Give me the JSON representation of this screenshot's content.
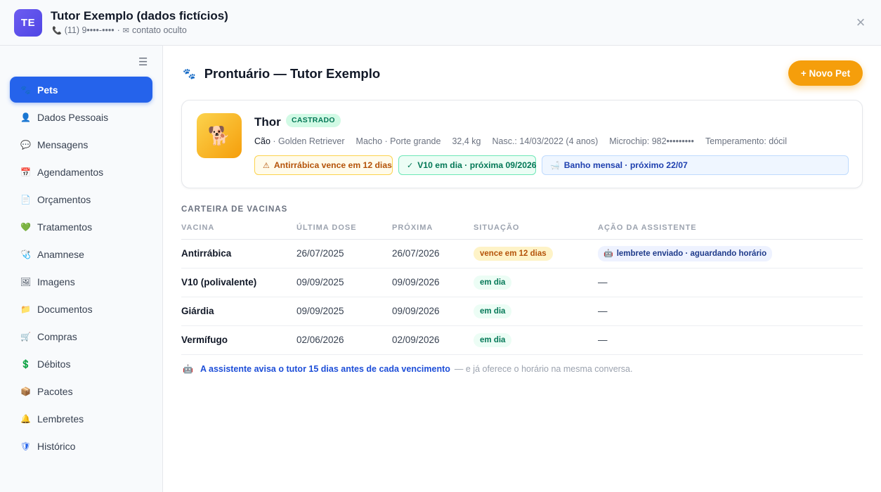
{
  "header": {
    "avatar_initials": "TE",
    "title": "Tutor Exemplo (dados fictícios)",
    "phone_icon": "phone-icon",
    "phone": "(11) 9••••-••••",
    "separator": "·",
    "email_icon": "envelope-icon",
    "email": "contato oculto",
    "close_label": "×"
  },
  "sidebar": {
    "menu_icon": "☰",
    "items": [
      {
        "label": "Pets",
        "icon": "🐾",
        "active": true
      },
      {
        "label": "Dados Pessoais",
        "icon": "👤"
      },
      {
        "label": "Mensagens",
        "icon": "💬"
      },
      {
        "label": "Agendamentos",
        "icon": "📅"
      },
      {
        "label": "Orçamentos",
        "icon": "📄"
      },
      {
        "label": "Tratamentos",
        "icon": "💚"
      },
      {
        "label": "Anamnese",
        "icon": "🩺"
      },
      {
        "label": "Imagens",
        "icon": "🖼"
      },
      {
        "label": "Documentos",
        "icon": "📁"
      },
      {
        "label": "Compras",
        "icon": "🛒"
      },
      {
        "label": "Débitos",
        "icon": "💲"
      },
      {
        "label": "Pacotes",
        "icon": "📦"
      },
      {
        "label": "Lembretes",
        "icon": "🔔"
      },
      {
        "label": "Histórico",
        "icon": "🛡"
      }
    ]
  },
  "main": {
    "title_icon": "🐾",
    "title": "Prontuário — Tutor Exemplo",
    "new_pet_label": "+ Novo Pet"
  },
  "pet": {
    "photo_icon": "🐕",
    "name": "Thor",
    "badge": "CASTRADO",
    "species": "Cão",
    "breed": " · Golden Retriever",
    "sex_size": "Macho · Porte grande",
    "weight": "32,4 kg",
    "birth": "Nasc.: 14/03/2022 (4 anos)",
    "microchip": "Microchip: 982•••••••••",
    "temperament": "Temperamento: dócil",
    "chips": {
      "warn_icon": "⚠",
      "warn": "Antirrábica vence em 12 dias",
      "ok_icon": "✓",
      "ok": "V10 em dia · próxima 09/2026",
      "info_icon": "🛁",
      "info": "Banho mensal · próximo 22/07"
    }
  },
  "vaccines": {
    "section_title": "CARTEIRA DE VACINAS",
    "columns": [
      "VACINA",
      "ÚLTIMA DOSE",
      "PRÓXIMA",
      "SITUAÇÃO",
      "AÇÃO DA ASSISTENTE"
    ],
    "rows": [
      {
        "name": "Antirrábica",
        "last": "26/07/2025",
        "next": "26/07/2026",
        "status": "vence em 12 dias",
        "status_type": "warn",
        "action_icon": "🤖",
        "action": "lembrete enviado · aguardando horário"
      },
      {
        "name": "V10 (polivalente)",
        "last": "09/09/2025",
        "next": "09/09/2026",
        "status": "em dia",
        "status_type": "ok",
        "action": "—"
      },
      {
        "name": "Giárdia",
        "last": "09/09/2025",
        "next": "09/09/2026",
        "status": "em dia",
        "status_type": "ok",
        "action": "—"
      },
      {
        "name": "Vermífugo",
        "last": "02/06/2026",
        "next": "02/09/2026",
        "status": "em dia",
        "status_type": "ok",
        "action": "—"
      }
    ],
    "note_icon": "🤖",
    "note_highlight": "A assistente avisa o tutor 15 dias antes de cada vencimento",
    "note_rest": "— e já oferece o horário na mesma conversa."
  }
}
